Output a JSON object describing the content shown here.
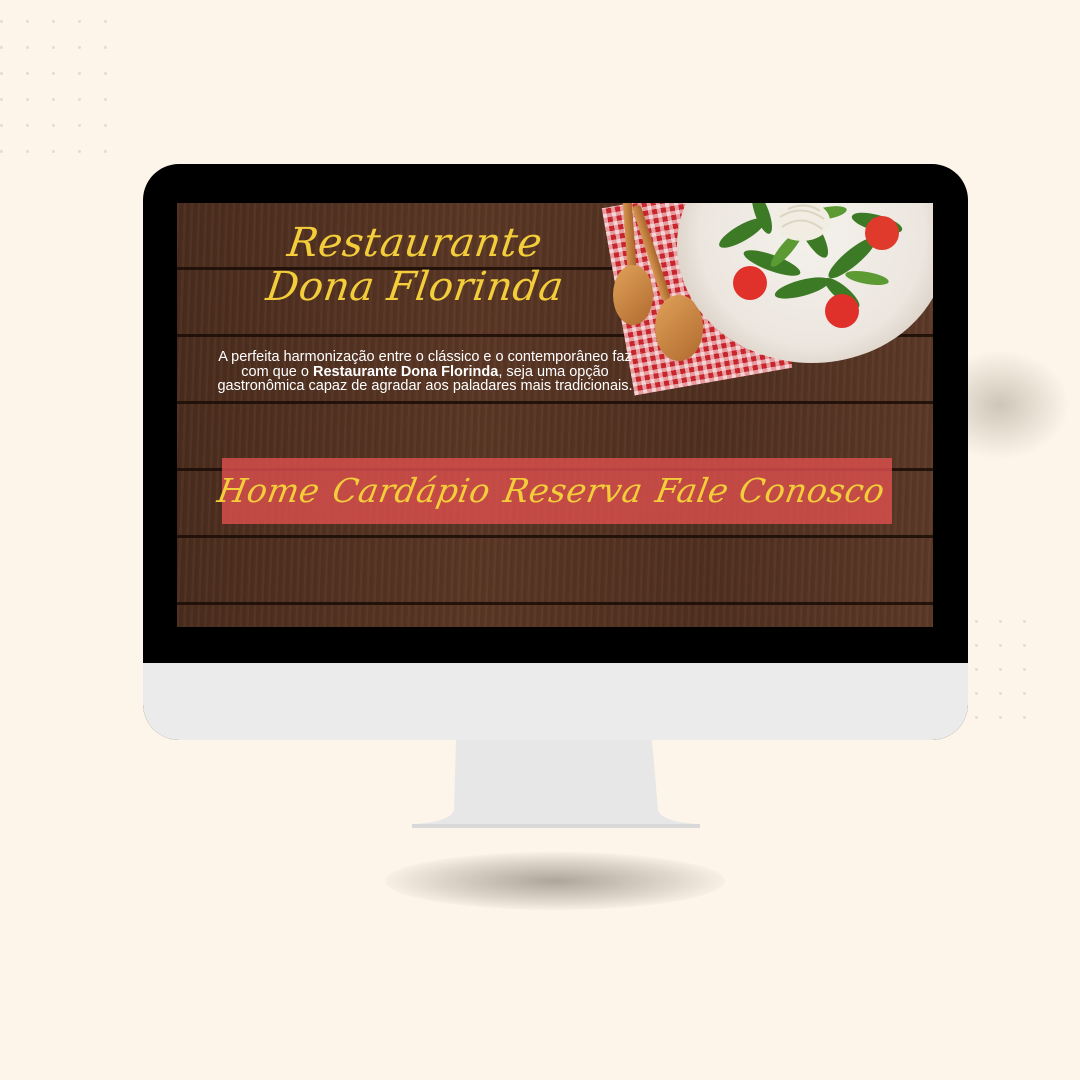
{
  "site": {
    "title_line1": "Restaurante",
    "title_line2": "Dona Florinda",
    "description": {
      "part1": "A perfeita harmonização entre o clássico e o contemporâneo faz com que o ",
      "highlight": "Restaurante Dona Florinda",
      "part2": ", seja uma opção gastronômica capaz de agradar aos paladares mais tradicionais."
    },
    "nav": [
      {
        "label": "Home"
      },
      {
        "label": "Cardápio"
      },
      {
        "label": "Reserva"
      },
      {
        "label": "Fale Conosco"
      }
    ]
  },
  "colors": {
    "background": "#fdf5e9",
    "accent_script": "#f3cd3a",
    "nav_band": "#de504e",
    "wood": "#4f2f1f",
    "monitor_bezel": "#000000",
    "monitor_chin": "#ebebeb"
  },
  "icons": [
    "salad-plate-image",
    "wooden-spoons-image",
    "checkered-napkin-image"
  ]
}
